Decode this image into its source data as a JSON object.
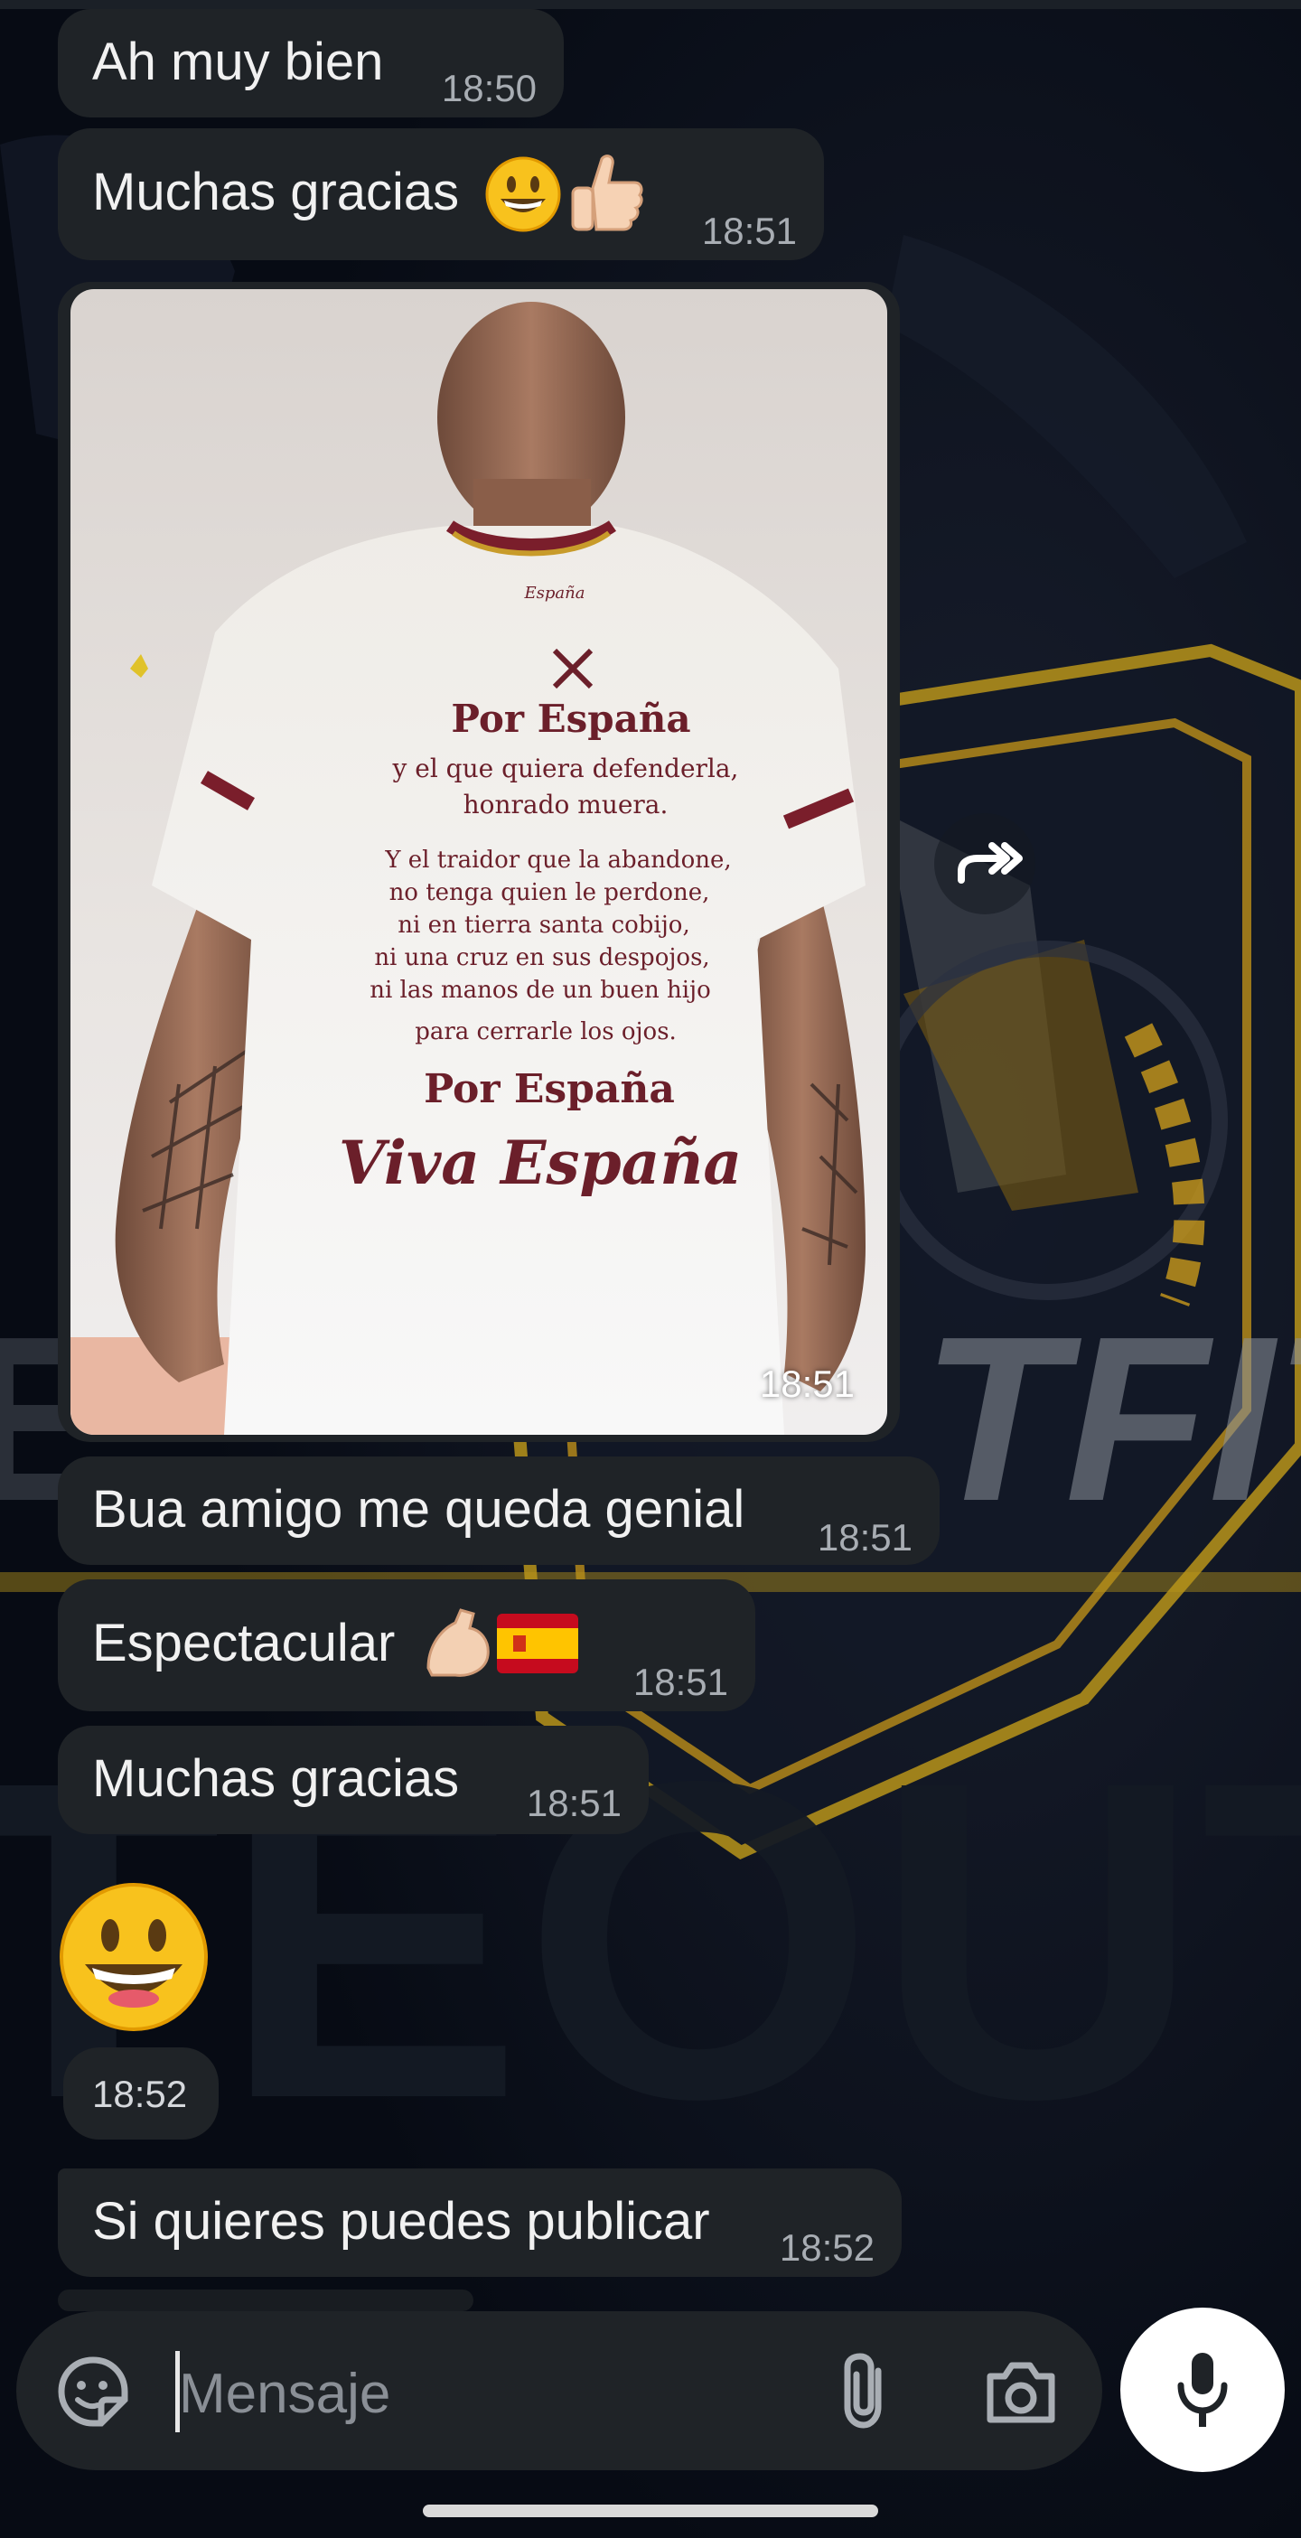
{
  "messages": [
    {
      "text": "Ah muy bien",
      "time": "18:50"
    },
    {
      "text": "Muchas gracias",
      "time": "18:51",
      "emojis": [
        "grinning-face",
        "thumbs-up"
      ]
    },
    {
      "type": "photo",
      "time": "18:51",
      "shirt": {
        "brand": "España",
        "lines": [
          "Por España",
          "y el que quiera defenderla,",
          "honrado muera.",
          "Y el traidor que la abandone,",
          "no tenga quien le perdone,",
          "ni en tierra santa cobijo,",
          "ni una cruz en sus despojos,",
          "ni las manos de un buen hijo",
          "para cerrarle los ojos.",
          "Por España",
          "Viva España"
        ]
      }
    },
    {
      "text": "Bua amigo me queda genial",
      "time": "18:51"
    },
    {
      "text": "Espectacular",
      "time": "18:51",
      "emojis": [
        "flexed-biceps",
        "spain-flag"
      ]
    },
    {
      "text": "Muchas gracias",
      "time": "18:51"
    },
    {
      "type": "emoji",
      "emoji": "grinning-face",
      "time": "18:52"
    },
    {
      "text": "Si quieres puedes publicar",
      "time": "18:52"
    }
  ],
  "input": {
    "placeholder": "Mensaje"
  },
  "wallpaper": {
    "text_1": "TFIT",
    "text_2": "TEOUT"
  },
  "colors": {
    "bubble": "#1f2327",
    "background": "#0a0f1a",
    "accent": "#d4a017",
    "time": "#a8adb3"
  },
  "icons": [
    "sticker-icon",
    "attach-icon",
    "camera-icon",
    "mic-icon",
    "forward-icon"
  ]
}
